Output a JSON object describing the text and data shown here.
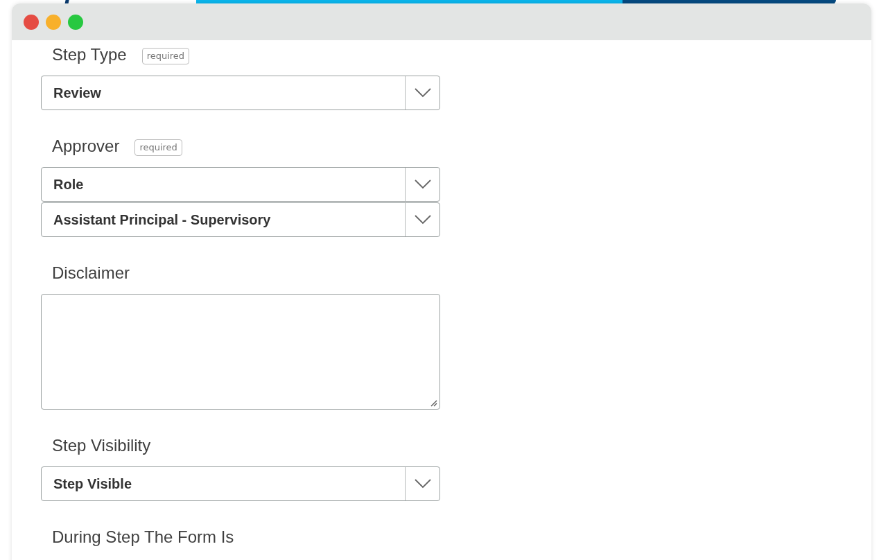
{
  "sections": [
    {
      "label": "Step Type",
      "badge": "required",
      "controls": [
        {
          "kind": "select",
          "value": "Review"
        }
      ]
    },
    {
      "label": "Approver",
      "badge": "required",
      "controls": [
        {
          "kind": "select",
          "value": "Role"
        },
        {
          "kind": "select",
          "value": "Assistant Principal - Supervisory"
        }
      ]
    },
    {
      "label": "Disclaimer",
      "controls": [
        {
          "kind": "textarea"
        }
      ]
    },
    {
      "label": "Step Visibility",
      "controls": [
        {
          "kind": "select",
          "value": "Step Visible"
        }
      ]
    },
    {
      "label": "During Step The Form Is"
    }
  ]
}
